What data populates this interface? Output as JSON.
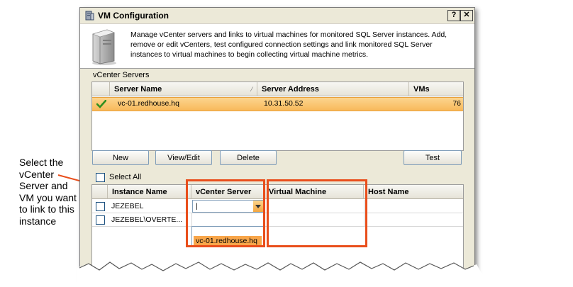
{
  "window": {
    "title": "VM Configuration",
    "help_label": "?",
    "close_label": "✕",
    "description": "Manage vCenter servers and links to virtual machines for monitored SQL Server instances. Add, remove or edit vCenters, test configured connection settings and link monitored SQL Server instances to virtual machines to begin collecting virtual machine metrics."
  },
  "vcenter": {
    "section_label": "vCenter Servers",
    "columns": [
      "Server Name",
      "Server Address",
      "VMs"
    ],
    "rows": [
      {
        "server_name": "vc-01.redhouse.hq",
        "server_address": "10.31.50.52",
        "vms": "76",
        "status_icon": "check-icon"
      }
    ]
  },
  "buttons": {
    "new": "New",
    "view_edit": "View/Edit",
    "delete": "Delete",
    "test": "Test"
  },
  "instances": {
    "select_all_label": "Select All",
    "columns": [
      "Instance Name",
      "vCenter Server",
      "Virtual Machine",
      "Host Name"
    ],
    "rows": [
      {
        "instance_name": "JEZEBEL",
        "vcenter_server": "|",
        "virtual_machine": "",
        "host_name": ""
      },
      {
        "instance_name": "JEZEBEL\\OVERTE...",
        "vcenter_server": "",
        "virtual_machine": "",
        "host_name": ""
      }
    ],
    "dropdown_options": [
      "vc-01.redhouse.hq"
    ]
  },
  "annotation": {
    "callout_text": "Select the vCenter Server and VM you want to link to this instance",
    "highlight_color": "#e94e1b"
  },
  "colors": {
    "selection": "#f8b95b",
    "window_bg": "#ece9d8"
  }
}
